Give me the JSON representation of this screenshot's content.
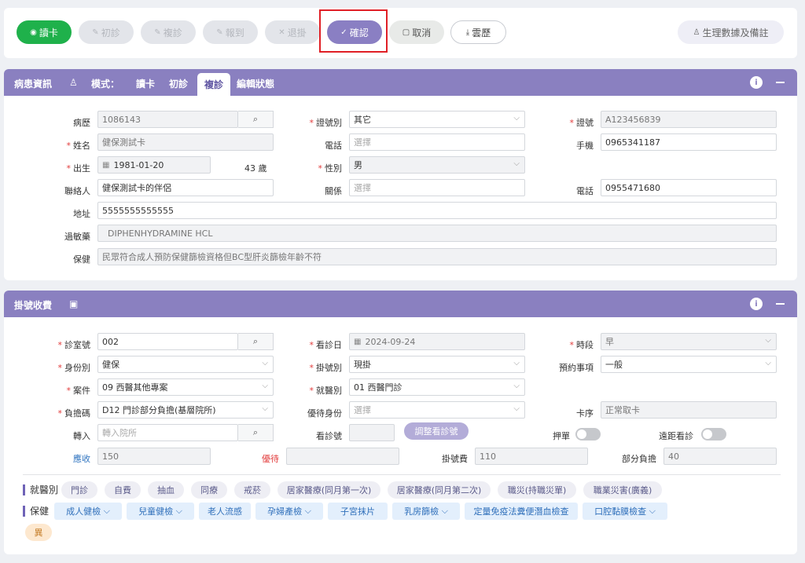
{
  "toolbar": {
    "read_card": "讀卡",
    "first_visit": "初診",
    "return_visit": "複診",
    "check_in": "報到",
    "withdraw": "退掛",
    "confirm": "確認",
    "cancel": "取消",
    "cloud_history": "雲歷",
    "vitals_notes": "生理數據及備註"
  },
  "patient": {
    "title": "病患資訊",
    "mode_label": "模式：",
    "modes": [
      "讀卡",
      "初診",
      "複診",
      "編輯狀態"
    ],
    "labels": {
      "record_no": "病歷",
      "id_type": "證號別",
      "id_no": "證號",
      "name": "姓名",
      "phone": "電話",
      "mobile": "手機",
      "birth": "出生",
      "gender": "性別",
      "contact": "聯絡人",
      "relation": "關係",
      "contact_phone": "電話",
      "address": "地址",
      "allergy": "過敏藥",
      "insurance": "保健"
    },
    "values": {
      "record_no": "1086143",
      "id_type": "其它",
      "id_no": "A123456839",
      "name": "健保測試卡",
      "phone_placeholder": "選擇",
      "mobile": "0965341187",
      "birth": "1981-01-20",
      "age": "43 歲",
      "gender": "男",
      "contact": "健保測試卡的伴侶",
      "relation_placeholder": "選擇",
      "contact_phone": "0955471680",
      "address": "5555555555555",
      "allergy": "DIPHENHYDRAMINE HCL",
      "insurance": "民眾符合成人預防保健篩檢資格但BC型肝炎篩檢年齡不符"
    }
  },
  "registration": {
    "title": "掛號收費",
    "labels": {
      "room": "診室號",
      "visit_date": "看診日",
      "period": "時段",
      "identity": "身份別",
      "reg_type": "掛號別",
      "appointment": "預約事項",
      "case": "案件",
      "medical_type": "就醫別",
      "copay_code": "負擔碼",
      "priority": "優待身份",
      "card_seq": "卡序",
      "transfer": "轉入",
      "visit_no": "看診號",
      "deposit": "押單",
      "remote": "遠距看診",
      "receivable": "應收",
      "discount": "優待",
      "reg_fee": "掛號費",
      "partial": "部分負擔"
    },
    "values": {
      "room": "002",
      "visit_date": "2024-09-24",
      "period": "早",
      "identity": "健保",
      "reg_type": "現掛",
      "appointment": "一般",
      "case": "09 西醫其他專案",
      "medical_type": "01 西醫門診",
      "copay_code": "D12 門診部分負擔(基層院所)",
      "priority_placeholder": "選擇",
      "card_seq": "正常取卡",
      "transfer_placeholder": "轉入院所",
      "adjust_button": "調整看診號",
      "receivable": "150",
      "reg_fee": "110",
      "partial": "40"
    },
    "medical_group_label": "就醫別",
    "medical_chips": [
      "門診",
      "自費",
      "抽血",
      "同療",
      "戒菸",
      "居家醫療(同月第一次)",
      "居家醫療(同月第二次)",
      "職災(持職災單)",
      "職業災害(廣義)"
    ],
    "health_group_label": "保健",
    "health_chips": [
      {
        "label": "成人健檢",
        "dropdown": true
      },
      {
        "label": "兒童健檢",
        "dropdown": true
      },
      {
        "label": "老人流感",
        "dropdown": false
      },
      {
        "label": "孕婦產檢",
        "dropdown": true
      },
      {
        "label": "子宮抹片",
        "dropdown": false
      },
      {
        "label": "乳房篩檢",
        "dropdown": true
      },
      {
        "label": "定量免疫法糞便潛血檢查",
        "dropdown": false
      },
      {
        "label": "口腔黏膜檢查",
        "dropdown": true
      }
    ],
    "abnormal_chip": "異"
  }
}
